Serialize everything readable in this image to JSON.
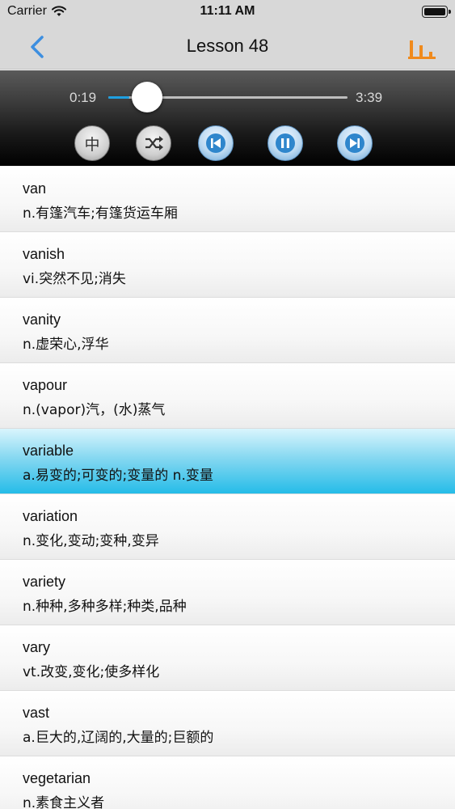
{
  "status_bar": {
    "carrier": "Carrier",
    "time": "11:11 AM"
  },
  "nav": {
    "title": "Lesson 48",
    "accent_back": "#3d8fe0",
    "accent_eq": "#f08a1c"
  },
  "player": {
    "current_time": "0:19",
    "total_time": "3:39",
    "progress": 0.087,
    "chinese_toggle": "中"
  },
  "words": [
    {
      "word": "van",
      "definition": "n.有篷汽车;有篷货运车厢"
    },
    {
      "word": "vanish",
      "definition": "vi.突然不见;消失"
    },
    {
      "word": "vanity",
      "definition": "n.虚荣心,浮华"
    },
    {
      "word": "vapour",
      "definition": "n.(vapor)汽，(水)蒸气"
    },
    {
      "word": "variable",
      "definition": "a.易变的;可变的;变量的 n.变量",
      "selected": true
    },
    {
      "word": "variation",
      "definition": "n.变化,变动;变种,变异"
    },
    {
      "word": "variety",
      "definition": "n.种种,多种多样;种类,品种"
    },
    {
      "word": "vary",
      "definition": "vt.改变,变化;使多样化"
    },
    {
      "word": "vast",
      "definition": "a.巨大的,辽阔的,大量的;巨额的"
    },
    {
      "word": "vegetarian",
      "definition": "n.素食主义者"
    }
  ]
}
